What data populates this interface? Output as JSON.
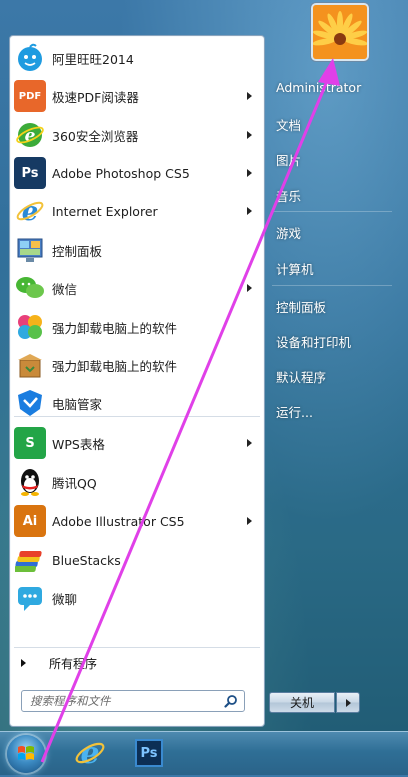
{
  "start_menu": {
    "programs": [
      {
        "label": "阿里旺旺2014",
        "icon": "aliwangwang-icon",
        "icon_text": "",
        "color": "#1f9be0",
        "arrow": false
      },
      {
        "label": "极速PDF阅读器",
        "icon": "pdf-reader-icon",
        "icon_text": "PDF",
        "color": "#e8672a",
        "arrow": true
      },
      {
        "label": "360安全浏览器",
        "icon": "360-browser-icon",
        "icon_text": "e",
        "color": "#3cab3a",
        "arrow": true
      },
      {
        "label": "Adobe Photoshop CS5",
        "icon": "photoshop-icon",
        "icon_text": "Ps",
        "color": "#163a63",
        "arrow": true
      },
      {
        "label": "Internet Explorer",
        "icon": "internet-explorer-icon",
        "icon_text": "e",
        "color": "#2a8ad6",
        "arrow": true
      },
      {
        "label": "控制面板",
        "icon": "control-panel-icon",
        "icon_text": "",
        "color": "#4a7fc4",
        "arrow": false
      },
      {
        "label": "微信",
        "icon": "wechat-icon",
        "icon_text": "",
        "color": "#47b634",
        "arrow": true
      },
      {
        "label": "强力卸载电脑上的软件",
        "icon": "uninstaller-icon",
        "icon_text": "",
        "color": "#e85f9a",
        "arrow": false
      },
      {
        "label": "强力卸载电脑上的软件",
        "icon": "uninstall-box-icon",
        "icon_text": "",
        "color": "#c98a3a",
        "arrow": false
      },
      {
        "label": "电脑管家",
        "icon": "pc-manager-icon",
        "icon_text": "",
        "color": "#1a7de0",
        "arrow": false
      },
      {
        "label": "WPS表格",
        "icon": "wps-sheet-icon",
        "icon_text": "S",
        "color": "#23a547",
        "arrow": true
      },
      {
        "label": "腾讯QQ",
        "icon": "qq-icon",
        "icon_text": "",
        "color": "#111111",
        "arrow": false
      },
      {
        "label": "Adobe Illustrator CS5",
        "icon": "illustrator-icon",
        "icon_text": "Ai",
        "color": "#d9740f",
        "arrow": true
      },
      {
        "label": "BlueStacks",
        "icon": "bluestacks-icon",
        "icon_text": "",
        "color": "#7cbf3a",
        "arrow": false
      },
      {
        "label": "微聊",
        "icon": "weiliao-icon",
        "icon_text": "",
        "color": "#2fa9e0",
        "arrow": false
      }
    ],
    "all_programs_label": "所有程序",
    "search_placeholder": "搜索程序和文件",
    "right_links": {
      "user": "Administrator",
      "documents": "文档",
      "pictures": "图片",
      "music": "音乐",
      "games": "游戏",
      "computer": "计算机",
      "control_panel": "控制面板",
      "devices_printers": "设备和打印机",
      "default_programs": "默认程序",
      "run": "运行..."
    },
    "shutdown_label": "关机"
  },
  "annotation": {
    "color": "#e040e8"
  },
  "taskbar": {
    "items": [
      "start-orb-icon",
      "internet-explorer-icon",
      "photoshop-icon"
    ],
    "ps_text": "Ps"
  }
}
